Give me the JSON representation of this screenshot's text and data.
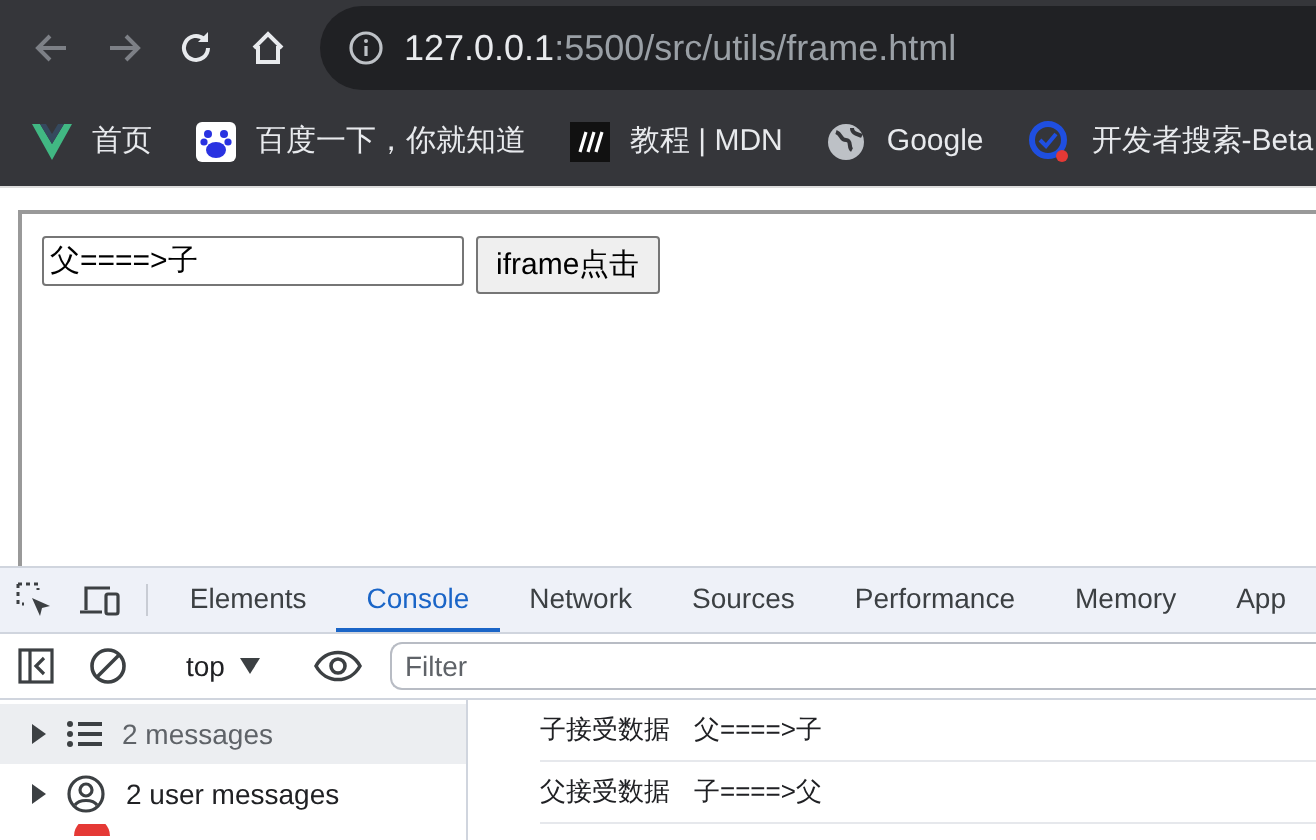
{
  "browser": {
    "url_host": "127.0.0.1",
    "url_path": ":5500/src/utils/frame.html"
  },
  "bookmarks": [
    {
      "kind": "vue",
      "label": "首页"
    },
    {
      "kind": "paw",
      "label": "百度一下，你就知道"
    },
    {
      "kind": "mdn",
      "label": "教程 | MDN"
    },
    {
      "kind": "globe",
      "label": "Google"
    },
    {
      "kind": "search",
      "label": "开发者搜索-Beta"
    }
  ],
  "page": {
    "input": {
      "value": "父====>子"
    },
    "button": "iframe点击"
  },
  "devtools": {
    "tabs": [
      {
        "label": "Elements",
        "selected": false
      },
      {
        "label": "Console",
        "selected": true
      },
      {
        "label": "Network",
        "selected": false
      },
      {
        "label": "Sources",
        "selected": false
      },
      {
        "label": "Performance",
        "selected": false
      },
      {
        "label": "Memory",
        "selected": false
      },
      {
        "label": "App",
        "selected": false
      }
    ],
    "context": "top",
    "filter": {
      "placeholder": "Filter"
    },
    "sidebar": [
      {
        "kind": "list",
        "label": "2 messages",
        "selected": true
      },
      {
        "kind": "user",
        "label": "2 user messages",
        "selected": false
      }
    ],
    "log": [
      {
        "label": "子接受数据",
        "value": "父====>子"
      },
      {
        "label": "父接受数据",
        "value": "子====>父"
      }
    ]
  }
}
